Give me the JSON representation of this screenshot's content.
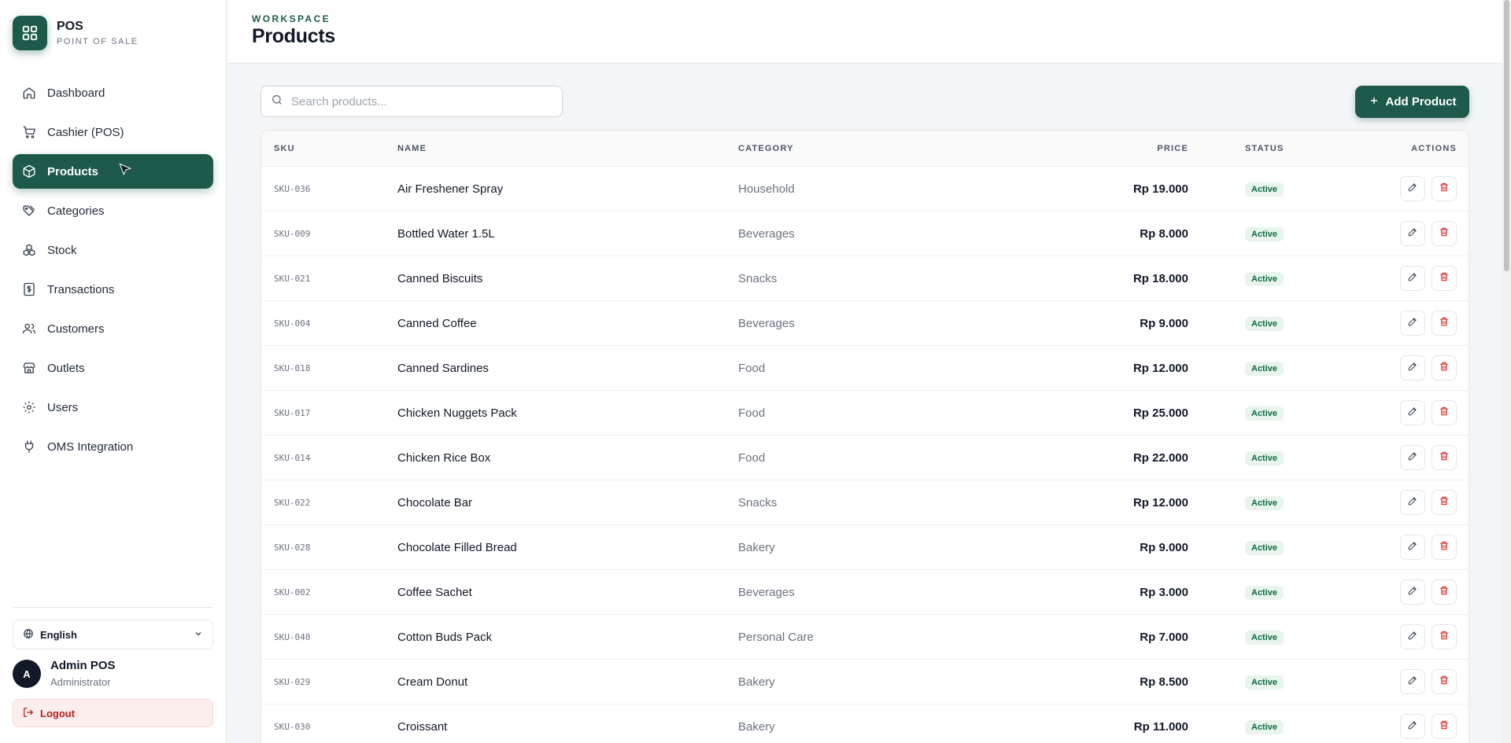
{
  "brand": {
    "title": "POS",
    "subtitle": "POINT OF SALE",
    "icon": "grid-icon"
  },
  "nav": [
    {
      "label": "Dashboard",
      "icon": "home-icon",
      "active": false
    },
    {
      "label": "Cashier (POS)",
      "icon": "cart-icon",
      "active": false
    },
    {
      "label": "Products",
      "icon": "package-icon",
      "active": true
    },
    {
      "label": "Categories",
      "icon": "tags-icon",
      "active": false
    },
    {
      "label": "Stock",
      "icon": "boxes-icon",
      "active": false
    },
    {
      "label": "Transactions",
      "icon": "receipt-icon",
      "active": false
    },
    {
      "label": "Customers",
      "icon": "users-icon",
      "active": false
    },
    {
      "label": "Outlets",
      "icon": "store-icon",
      "active": false
    },
    {
      "label": "Users",
      "icon": "gear-icon",
      "active": false
    },
    {
      "label": "OMS Integration",
      "icon": "plug-icon",
      "active": false
    }
  ],
  "language": {
    "selected": "English"
  },
  "user": {
    "initial": "A",
    "name": "Admin POS",
    "role": "Administrator"
  },
  "logout": {
    "label": "Logout"
  },
  "header": {
    "eyebrow": "WORKSPACE",
    "title": "Products"
  },
  "search": {
    "placeholder": "Search products...",
    "value": ""
  },
  "add_button": {
    "label": "Add Product"
  },
  "table": {
    "columns": {
      "sku": "SKU",
      "name": "NAME",
      "category": "CATEGORY",
      "price": "PRICE",
      "status": "STATUS",
      "actions": "ACTIONS"
    },
    "rows": [
      {
        "sku": "SKU-036",
        "name": "Air Freshener Spray",
        "category": "Household",
        "price": "Rp 19.000",
        "status": "Active"
      },
      {
        "sku": "SKU-009",
        "name": "Bottled Water 1.5L",
        "category": "Beverages",
        "price": "Rp 8.000",
        "status": "Active"
      },
      {
        "sku": "SKU-021",
        "name": "Canned Biscuits",
        "category": "Snacks",
        "price": "Rp 18.000",
        "status": "Active"
      },
      {
        "sku": "SKU-004",
        "name": "Canned Coffee",
        "category": "Beverages",
        "price": "Rp 9.000",
        "status": "Active"
      },
      {
        "sku": "SKU-018",
        "name": "Canned Sardines",
        "category": "Food",
        "price": "Rp 12.000",
        "status": "Active"
      },
      {
        "sku": "SKU-017",
        "name": "Chicken Nuggets Pack",
        "category": "Food",
        "price": "Rp 25.000",
        "status": "Active"
      },
      {
        "sku": "SKU-014",
        "name": "Chicken Rice Box",
        "category": "Food",
        "price": "Rp 22.000",
        "status": "Active"
      },
      {
        "sku": "SKU-022",
        "name": "Chocolate Bar",
        "category": "Snacks",
        "price": "Rp 12.000",
        "status": "Active"
      },
      {
        "sku": "SKU-028",
        "name": "Chocolate Filled Bread",
        "category": "Bakery",
        "price": "Rp 9.000",
        "status": "Active"
      },
      {
        "sku": "SKU-002",
        "name": "Coffee Sachet",
        "category": "Beverages",
        "price": "Rp 3.000",
        "status": "Active"
      },
      {
        "sku": "SKU-040",
        "name": "Cotton Buds Pack",
        "category": "Personal Care",
        "price": "Rp 7.000",
        "status": "Active"
      },
      {
        "sku": "SKU-029",
        "name": "Cream Donut",
        "category": "Bakery",
        "price": "Rp 8.500",
        "status": "Active"
      },
      {
        "sku": "SKU-030",
        "name": "Croissant",
        "category": "Bakery",
        "price": "Rp 11.000",
        "status": "Active"
      }
    ]
  },
  "colors": {
    "accent": "#1d5a4c",
    "danger": "#dc2626",
    "badge_bg": "#e7f5ec",
    "badge_text": "#0f6b3e"
  }
}
